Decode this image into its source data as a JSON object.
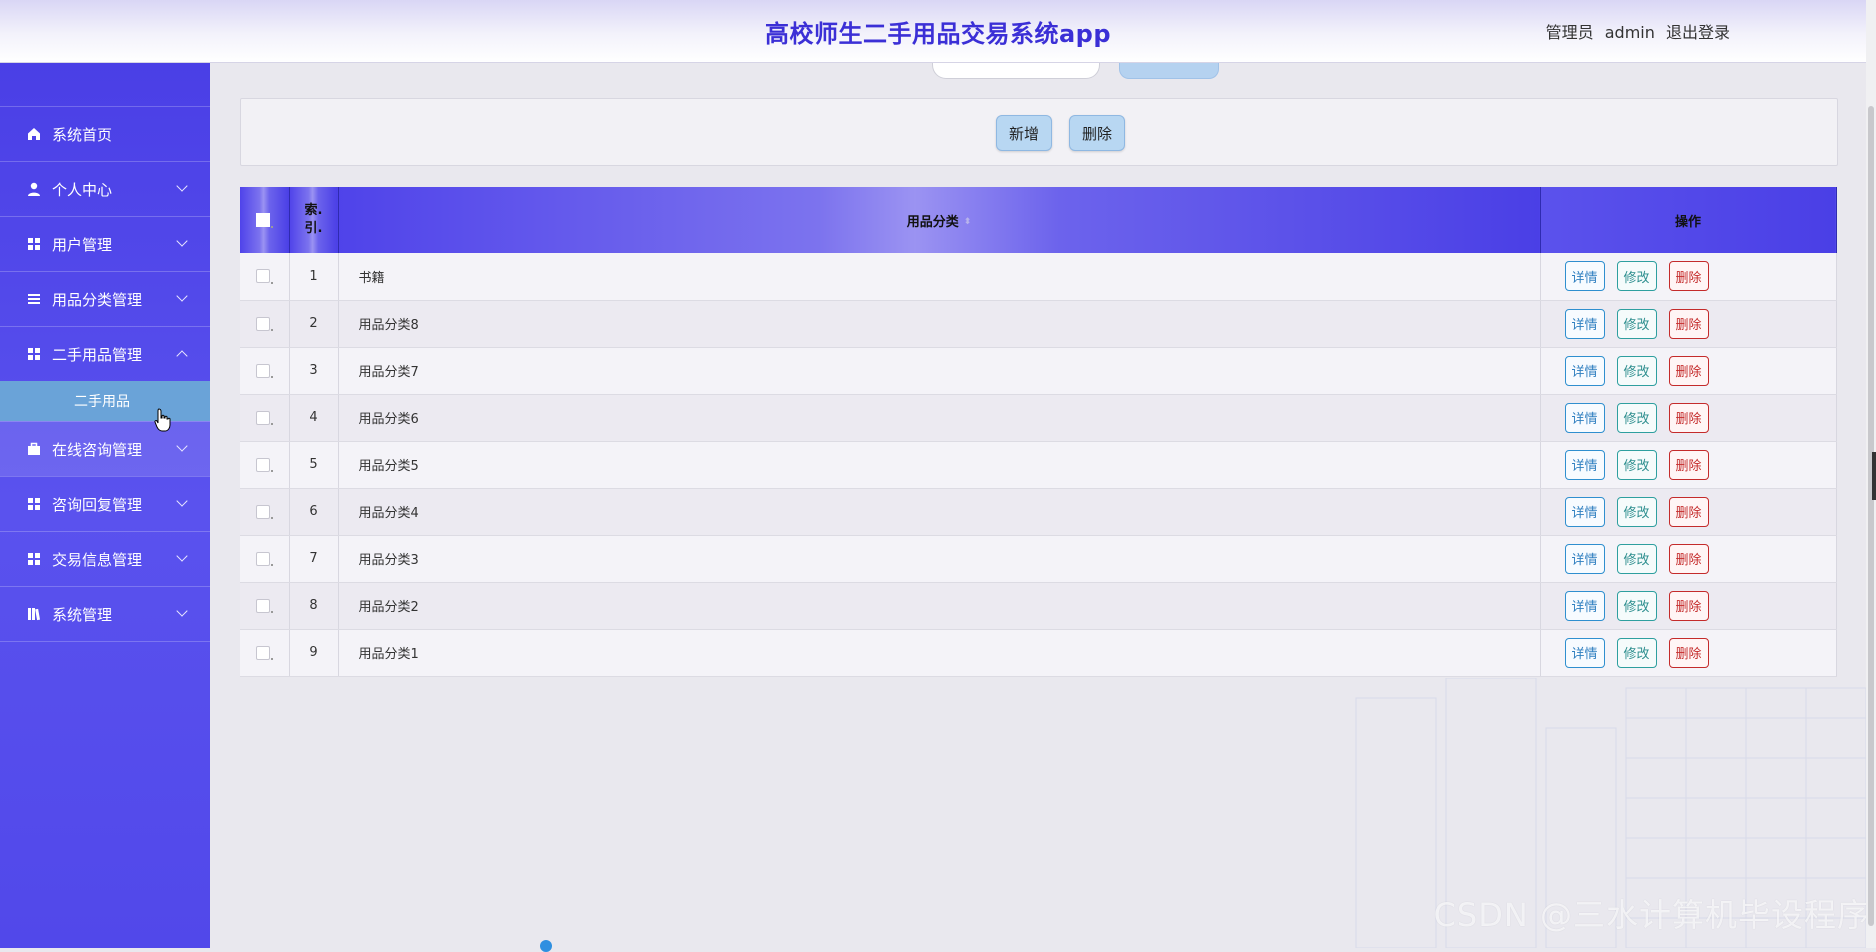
{
  "header": {
    "title": "高校师生二手用品交易系统app",
    "role_label": "管理员",
    "username": "admin",
    "logout_label": "退出登录"
  },
  "sidebar": {
    "items": [
      {
        "label": "系统首页",
        "icon": "home-icon"
      },
      {
        "label": "个人中心",
        "icon": "user-icon"
      },
      {
        "label": "用户管理",
        "icon": "grid-icon"
      },
      {
        "label": "用品分类管理",
        "icon": "list-icon"
      },
      {
        "label": "二手用品管理",
        "icon": "grid-icon",
        "expanded": true
      },
      {
        "label": "在线咨询管理",
        "icon": "briefcase-icon"
      },
      {
        "label": "咨询回复管理",
        "icon": "grid-icon"
      },
      {
        "label": "交易信息管理",
        "icon": "grid-icon"
      },
      {
        "label": "系统管理",
        "icon": "book-icon"
      }
    ],
    "submenu_label": "二手用品"
  },
  "toolbar": {
    "add_label": "新增",
    "delete_label": "删除"
  },
  "table": {
    "headers": {
      "index": "索.\n引.",
      "category": "用品分类",
      "actions": "操作"
    },
    "rows": [
      {
        "index": "1",
        "name": "书籍"
      },
      {
        "index": "2",
        "name": "用品分类8"
      },
      {
        "index": "3",
        "name": "用品分类7"
      },
      {
        "index": "4",
        "name": "用品分类6"
      },
      {
        "index": "5",
        "name": "用品分类5"
      },
      {
        "index": "6",
        "name": "用品分类4"
      },
      {
        "index": "7",
        "name": "用品分类3"
      },
      {
        "index": "8",
        "name": "用品分类2"
      },
      {
        "index": "9",
        "name": "用品分类1"
      }
    ],
    "row_actions": {
      "detail": "详情",
      "edit": "修改",
      "delete": "删除"
    }
  },
  "watermark": "CSDN @三水计算机毕设程序",
  "colors": {
    "sidebar": "#4a3fe6",
    "title": "#3b2fd6",
    "submenu_active": "#6aa3d8"
  }
}
